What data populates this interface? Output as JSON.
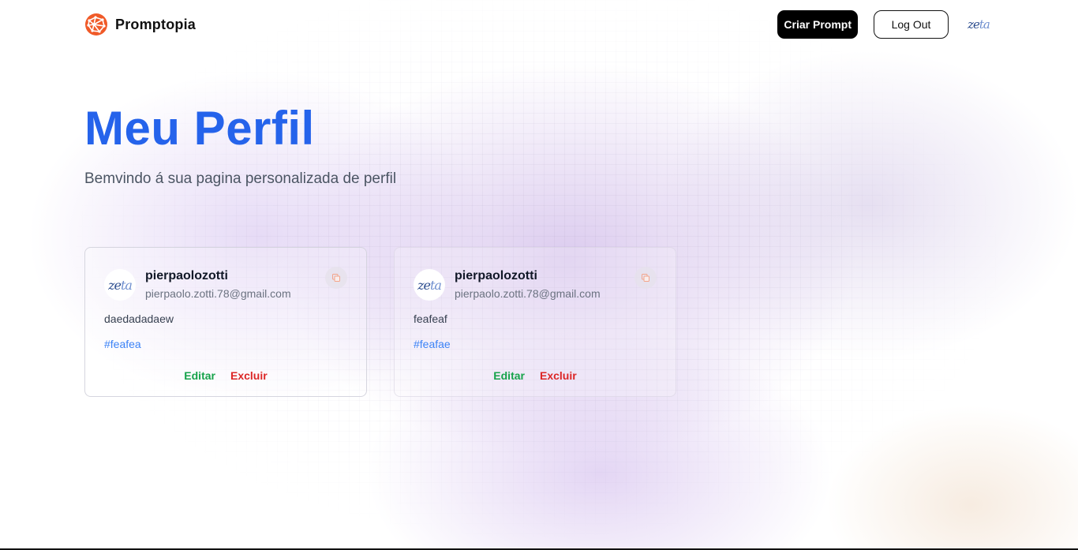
{
  "colors": {
    "title": "#2563eb",
    "edit": "#16a34a",
    "delete": "#dc2626",
    "tag": "#3b82f6",
    "brand_logo": "#f97316"
  },
  "nav": {
    "brand": "Promptopia",
    "brand_icon": "globe-network-logo",
    "create_button": "Criar Prompt",
    "logout_button": "Log Out",
    "avatar_text_a": "ze",
    "avatar_text_b": "ta"
  },
  "hero": {
    "title": "Meu Perfil",
    "subtitle": "Bemvindo á sua pagina personalizada de perfil"
  },
  "prompts": [
    {
      "avatar_text_a": "ze",
      "avatar_text_b": "ta",
      "username": "pierpaolozotti",
      "email": "pierpaolo.zotti.78@gmail.com",
      "copy_icon": "copy-icon",
      "text": "daedadadaew",
      "tag": "#feafea",
      "edit_label": "Editar",
      "delete_label": "Excluir"
    },
    {
      "avatar_text_a": "ze",
      "avatar_text_b": "ta",
      "username": "pierpaolozotti",
      "email": "pierpaolo.zotti.78@gmail.com",
      "copy_icon": "copy-icon",
      "text": "feafeaf",
      "tag": "#feafae",
      "edit_label": "Editar",
      "delete_label": "Excluir"
    }
  ]
}
